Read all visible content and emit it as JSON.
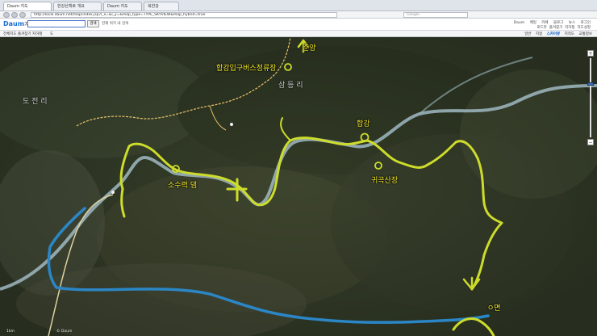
{
  "browser": {
    "tabs": [
      {
        "label": "Daum 지도",
        "active": true
      },
      {
        "label": "한강산책로 개요",
        "active": false
      },
      {
        "label": "Daum 지도",
        "active": false
      },
      {
        "label": "북한강",
        "active": false
      }
    ],
    "address": "http://local.daum.net/map/index.jsp?l_x=&l_y=&map_type=TYPE_SKYVIEW&map_hybrid=true",
    "title": "Daum 지도",
    "search_placeholder": "Google"
  },
  "header": {
    "logo": "Daum",
    "logo_sub": "지도",
    "search_button": "검색",
    "search_option": "현재 위치 내 검색",
    "top_links": [
      "Daum",
      "메일",
      "카페",
      "블로그",
      "뉴스",
      "로그인"
    ],
    "sub_links": [
      "로드뷰",
      "즐겨찾기",
      "지하철",
      "지도설정"
    ]
  },
  "toolbar": {
    "items": [
      "전체지도",
      "즐겨찾기",
      "지하철",
      "도"
    ],
    "view_tabs": [
      "일반",
      "지형",
      "스카이뷰",
      "지적도",
      "교통정보"
    ],
    "active_view": "스카이뷰"
  },
  "map": {
    "labels": {
      "chuncheon": "춘양",
      "bus_stop": "합강입구버스정류장",
      "samdeung": "삼 등 리",
      "docheon": "도 전 리",
      "hangang": "합강",
      "dam": "소수력 댐",
      "gwigok": "귀곡산장",
      "myeon": "ㅇ면"
    },
    "scale": "1km",
    "copyright": "© Daum"
  },
  "colors": {
    "route_yellow": "#cddc2b",
    "route_blue": "#2b86c6",
    "river": "#9fb9c2",
    "road": "#e8c46a"
  }
}
